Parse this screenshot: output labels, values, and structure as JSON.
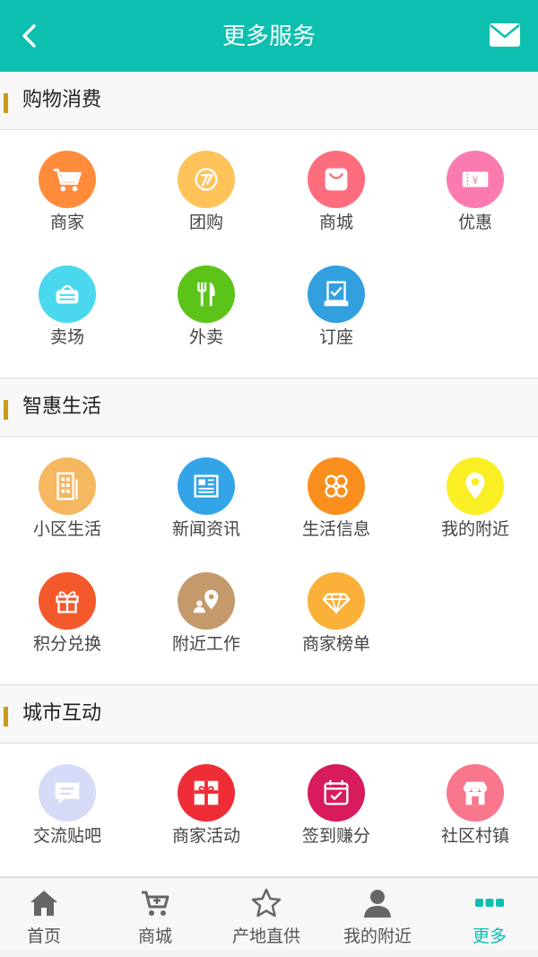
{
  "header": {
    "title": "更多服务"
  },
  "colors": {
    "accent": "#0cbfae",
    "section_bar": "#c89a1e"
  },
  "sections": [
    {
      "title": "购物消费",
      "items": [
        {
          "label": "商家",
          "icon": "shopping-cart-icon",
          "color": "#ff8c3b"
        },
        {
          "label": "团购",
          "icon": "group-buy-icon",
          "color": "#ffc35a"
        },
        {
          "label": "商城",
          "icon": "shopping-bag-icon",
          "color": "#fd6d7e"
        },
        {
          "label": "优惠",
          "icon": "coupon-icon",
          "color": "#fb7bb0"
        },
        {
          "label": "卖场",
          "icon": "basket-icon",
          "color": "#4ad8ef"
        },
        {
          "label": "外卖",
          "icon": "fork-knife-icon",
          "color": "#5cc318"
        },
        {
          "label": "订座",
          "icon": "reservation-icon",
          "color": "#32a0df"
        }
      ]
    },
    {
      "title": "智惠生活",
      "items": [
        {
          "label": "小区生活",
          "icon": "building-icon",
          "color": "#f5b760"
        },
        {
          "label": "新闻资讯",
          "icon": "newspaper-icon",
          "color": "#34a4e9"
        },
        {
          "label": "生活信息",
          "icon": "clover-icon",
          "color": "#fb8f1e"
        },
        {
          "label": "我的附近",
          "icon": "location-pin-icon",
          "color": "#faee24"
        },
        {
          "label": "积分兑换",
          "icon": "gift-icon",
          "color": "#f4592c"
        },
        {
          "label": "附近工作",
          "icon": "person-pin-icon",
          "color": "#c49a6c"
        },
        {
          "label": "商家榜单",
          "icon": "diamond-icon",
          "color": "#fbb03a"
        }
      ]
    },
    {
      "title": "城市互动",
      "items": [
        {
          "label": "交流贴吧",
          "icon": "chat-bubble-icon",
          "color": "#d6dbf7"
        },
        {
          "label": "商家活动",
          "icon": "gift-box-icon",
          "color": "#ee2d36"
        },
        {
          "label": "签到赚分",
          "icon": "calendar-check-icon",
          "color": "#d81b5e"
        },
        {
          "label": "社区村镇",
          "icon": "storefront-icon",
          "color": "#f8778c"
        }
      ]
    }
  ],
  "tabs": [
    {
      "label": "首页",
      "icon": "home-icon",
      "active": false
    },
    {
      "label": "商城",
      "icon": "cart-plus-icon",
      "active": false
    },
    {
      "label": "产地直供",
      "icon": "star-icon",
      "active": false
    },
    {
      "label": "我的附近",
      "icon": "person-icon",
      "active": false
    },
    {
      "label": "更多",
      "icon": "more-dots-icon",
      "active": true
    }
  ]
}
